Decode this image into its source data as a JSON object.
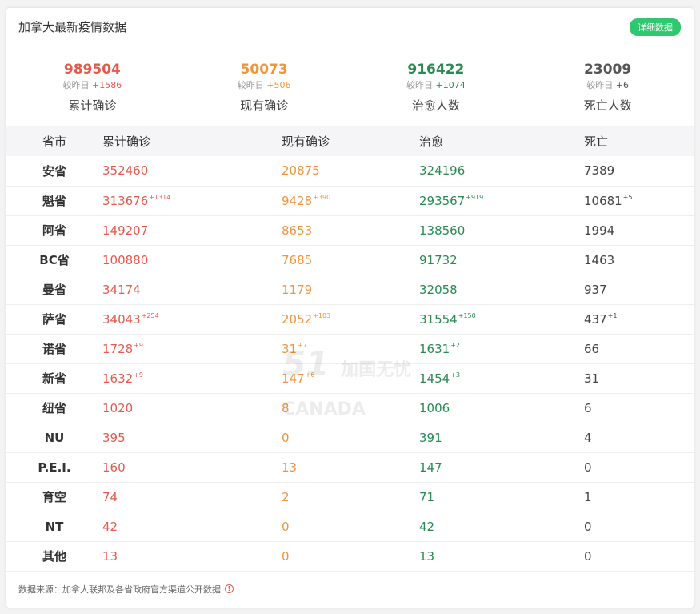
{
  "header": {
    "title": "加拿大最新疫情数据",
    "detail_button": "详细数据"
  },
  "summary": {
    "delta_prefix": "较昨日",
    "items": [
      {
        "value": "989504",
        "delta": "+1586",
        "label": "累计确诊",
        "color": "#e55a4e"
      },
      {
        "value": "50073",
        "delta": "+506",
        "label": "现有确诊",
        "color": "#f0953a"
      },
      {
        "value": "916422",
        "delta": "+1074",
        "label": "治愈人数",
        "color": "#2a8a52"
      },
      {
        "value": "23009",
        "delta": "+6",
        "label": "死亡人数",
        "color": "#555555"
      }
    ]
  },
  "table": {
    "headers": [
      "省市",
      "累计确诊",
      "现有确诊",
      "治愈",
      "死亡"
    ],
    "rows": [
      {
        "prov": "安省",
        "total": "352460",
        "total_d": "",
        "cur": "20875",
        "cur_d": "",
        "rec": "324196",
        "rec_d": "",
        "death": "7389",
        "death_d": ""
      },
      {
        "prov": "魁省",
        "total": "313676",
        "total_d": "+1314",
        "cur": "9428",
        "cur_d": "+390",
        "rec": "293567",
        "rec_d": "+919",
        "death": "10681",
        "death_d": "+5"
      },
      {
        "prov": "阿省",
        "total": "149207",
        "total_d": "",
        "cur": "8653",
        "cur_d": "",
        "rec": "138560",
        "rec_d": "",
        "death": "1994",
        "death_d": ""
      },
      {
        "prov": "BC省",
        "total": "100880",
        "total_d": "",
        "cur": "7685",
        "cur_d": "",
        "rec": "91732",
        "rec_d": "",
        "death": "1463",
        "death_d": ""
      },
      {
        "prov": "曼省",
        "total": "34174",
        "total_d": "",
        "cur": "1179",
        "cur_d": "",
        "rec": "32058",
        "rec_d": "",
        "death": "937",
        "death_d": ""
      },
      {
        "prov": "萨省",
        "total": "34043",
        "total_d": "+254",
        "cur": "2052",
        "cur_d": "+103",
        "rec": "31554",
        "rec_d": "+150",
        "death": "437",
        "death_d": "+1"
      },
      {
        "prov": "诺省",
        "total": "1728",
        "total_d": "+9",
        "cur": "31",
        "cur_d": "+7",
        "rec": "1631",
        "rec_d": "+2",
        "death": "66",
        "death_d": ""
      },
      {
        "prov": "新省",
        "total": "1632",
        "total_d": "+9",
        "cur": "147",
        "cur_d": "+6",
        "rec": "1454",
        "rec_d": "+3",
        "death": "31",
        "death_d": ""
      },
      {
        "prov": "纽省",
        "total": "1020",
        "total_d": "",
        "cur": "8",
        "cur_d": "",
        "rec": "1006",
        "rec_d": "",
        "death": "6",
        "death_d": ""
      },
      {
        "prov": "NU",
        "total": "395",
        "total_d": "",
        "cur": "0",
        "cur_d": "",
        "rec": "391",
        "rec_d": "",
        "death": "4",
        "death_d": ""
      },
      {
        "prov": "P.E.I.",
        "total": "160",
        "total_d": "",
        "cur": "13",
        "cur_d": "",
        "rec": "147",
        "rec_d": "",
        "death": "0",
        "death_d": ""
      },
      {
        "prov": "育空",
        "total": "74",
        "total_d": "",
        "cur": "2",
        "cur_d": "",
        "rec": "71",
        "rec_d": "",
        "death": "1",
        "death_d": ""
      },
      {
        "prov": "NT",
        "total": "42",
        "total_d": "",
        "cur": "0",
        "cur_d": "",
        "rec": "42",
        "rec_d": "",
        "death": "0",
        "death_d": ""
      },
      {
        "prov": "其他",
        "total": "13",
        "total_d": "",
        "cur": "0",
        "cur_d": "",
        "rec": "13",
        "rec_d": "",
        "death": "0",
        "death_d": ""
      }
    ]
  },
  "footer": {
    "source": "数据来源：加拿大联邦及各省政府官方渠道公开数据",
    "info_icon": "info-icon"
  },
  "watermark": {
    "number": "51",
    "text": "加国无忧",
    "sub": "CANADA"
  },
  "colors": {
    "accent": "#2fc76f",
    "confirmed": "#e55a4e",
    "current": "#f0953a",
    "recovered": "#2a8a52"
  }
}
